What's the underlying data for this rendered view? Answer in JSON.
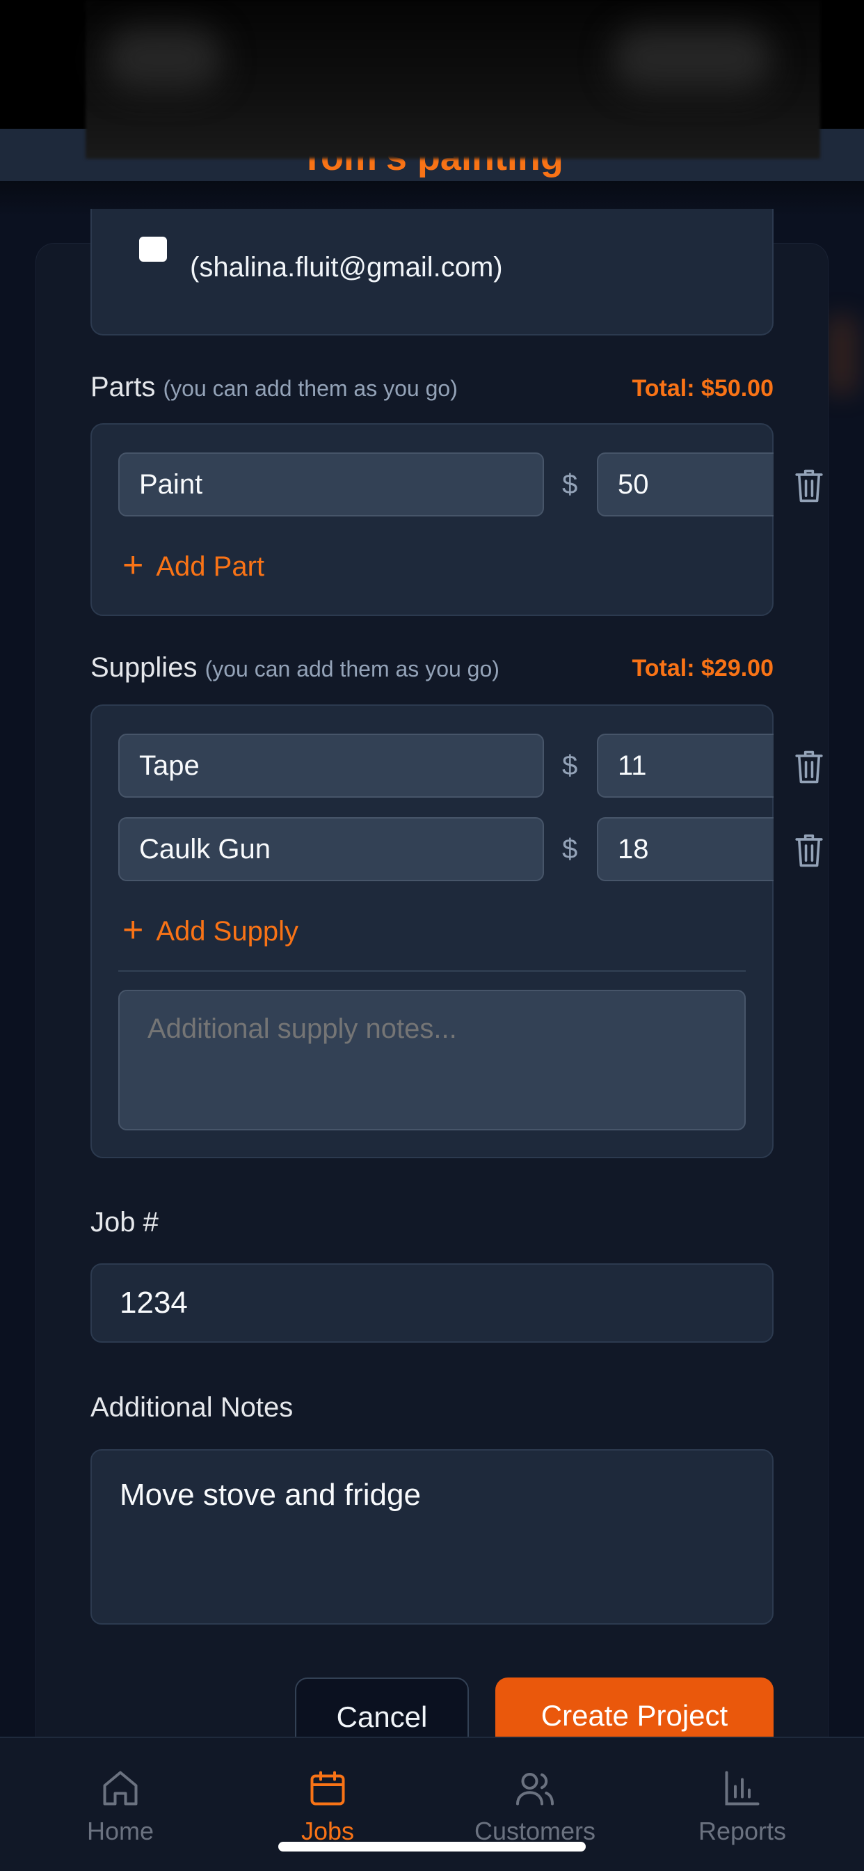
{
  "header": {
    "company_name": "Tom's painting"
  },
  "customer": {
    "email": "(shalina.fluit@gmail.com)"
  },
  "parts": {
    "label": "Parts",
    "hint": "(you can add them as you go)",
    "total": "Total: $50.00",
    "items": [
      {
        "name": "Paint",
        "currency": "$",
        "amount": "50"
      }
    ],
    "add_label": "Add Part"
  },
  "supplies": {
    "label": "Supplies",
    "hint": "(you can add them as you go)",
    "total": "Total: $29.00",
    "items": [
      {
        "name": "Tape",
        "currency": "$",
        "amount": "11"
      },
      {
        "name": "Caulk Gun",
        "currency": "$",
        "amount": "18"
      }
    ],
    "add_label": "Add Supply",
    "notes_placeholder": "Additional supply notes..."
  },
  "job_number": {
    "label": "Job #",
    "value": "1234"
  },
  "additional_notes": {
    "label": "Additional Notes",
    "value": "Move stove and fridge"
  },
  "actions": {
    "cancel_label": "Cancel",
    "create_label": "Create Project"
  },
  "nav": {
    "items": [
      {
        "label": "Home",
        "icon": "home-icon"
      },
      {
        "label": "Jobs",
        "icon": "calendar-icon",
        "active": true
      },
      {
        "label": "Customers",
        "icon": "users-icon"
      },
      {
        "label": "Reports",
        "icon": "bar-chart-icon"
      }
    ]
  },
  "colors": {
    "accent": "#f97316",
    "background": "#0b1120",
    "card": "#1e293b",
    "input": "#334155"
  }
}
